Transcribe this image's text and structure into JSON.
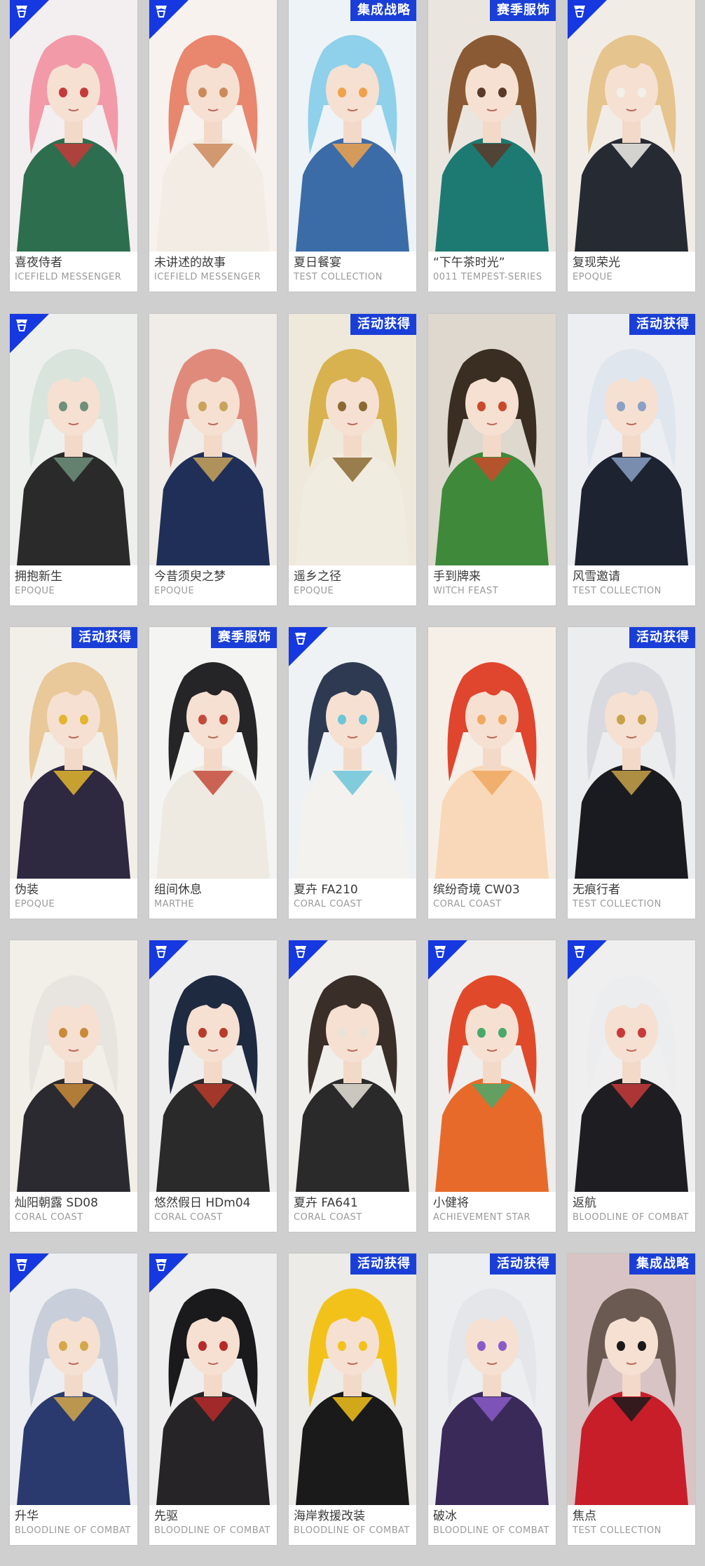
{
  "rows": [
    [
      {
        "name": "喜夜侍者",
        "series": "ICEFIELD MESSENGER",
        "tag": "",
        "corner": true,
        "palette": {
          "bg": "#f3eef0",
          "hair": "#f29aa8",
          "cloth": "#2d6e4e",
          "accent": "#c43a3a"
        }
      },
      {
        "name": "未讲述的故事",
        "series": "ICEFIELD MESSENGER",
        "tag": "",
        "corner": true,
        "palette": {
          "bg": "#f7f2ee",
          "hair": "#e8866e",
          "cloth": "#f2ece4",
          "accent": "#cc8a5a"
        }
      },
      {
        "name": "夏日餐宴",
        "series": "TEST COLLECTION",
        "tag": "集成战略",
        "corner": false,
        "palette": {
          "bg": "#eef3f7",
          "hair": "#8fd0ea",
          "cloth": "#3b6ca8",
          "accent": "#f0a24b"
        }
      },
      {
        "name": "“下午茶时光”",
        "series": "0011 TEMPEST-SERIES",
        "tag": "赛季服饰",
        "corner": false,
        "palette": {
          "bg": "#eae6df",
          "hair": "#8a5a34",
          "cloth": "#1d7a72",
          "accent": "#5a3a2a"
        }
      },
      {
        "name": "复现荣光",
        "series": "EPOQUE",
        "tag": "",
        "corner": true,
        "palette": {
          "bg": "#f1ede6",
          "hair": "#e6c48e",
          "cloth": "#262a33",
          "accent": "#f2f0ea"
        }
      }
    ],
    [
      {
        "name": "拥抱新生",
        "series": "EPOQUE",
        "tag": "",
        "corner": true,
        "palette": {
          "bg": "#eef0ee",
          "hair": "#d9e4dc",
          "cloth": "#2a2a2a",
          "accent": "#6f8f7a"
        }
      },
      {
        "name": "今昔须臾之梦",
        "series": "EPOQUE",
        "tag": "",
        "corner": false,
        "palette": {
          "bg": "#f0ece8",
          "hair": "#e08a7c",
          "cloth": "#1f2f57",
          "accent": "#c8a35a"
        }
      },
      {
        "name": "遥乡之径",
        "series": "EPOQUE",
        "tag": "活动获得",
        "corner": false,
        "palette": {
          "bg": "#efe9dc",
          "hair": "#d8b24e",
          "cloth": "#f0ece0",
          "accent": "#8a6a32"
        }
      },
      {
        "name": "手到牌来",
        "series": "WITCH FEAST",
        "tag": "",
        "corner": false,
        "palette": {
          "bg": "#ded8cf",
          "hair": "#3a2e22",
          "cloth": "#3e8a3a",
          "accent": "#c94a2a"
        }
      },
      {
        "name": "风雪邀请",
        "series": "TEST COLLECTION",
        "tag": "活动获得",
        "corner": false,
        "palette": {
          "bg": "#eceef2",
          "hair": "#dfe6ee",
          "cloth": "#1d2330",
          "accent": "#8aa0c4"
        }
      }
    ],
    [
      {
        "name": "伪装",
        "series": "EPOQUE",
        "tag": "活动获得",
        "corner": false,
        "palette": {
          "bg": "#f2efe9",
          "hair": "#e9c89a",
          "cloth": "#2e2840",
          "accent": "#e2b62e"
        }
      },
      {
        "name": "组间休息",
        "series": "MARTHE",
        "tag": "赛季服饰",
        "corner": false,
        "palette": {
          "bg": "#f4f4f2",
          "hair": "#252527",
          "cloth": "#eeeae2",
          "accent": "#c44a3a"
        }
      },
      {
        "name": "夏卉 FA210",
        "series": "CORAL COAST",
        "tag": "",
        "corner": true,
        "palette": {
          "bg": "#eef2f4",
          "hair": "#2e3a52",
          "cloth": "#f4f2ee",
          "accent": "#6cc6d8"
        }
      },
      {
        "name": "缤纷奇境 CW03",
        "series": "CORAL COAST",
        "tag": "",
        "corner": false,
        "palette": {
          "bg": "#f6efe8",
          "hair": "#e0452e",
          "cloth": "#f8d8b8",
          "accent": "#f0a860"
        }
      },
      {
        "name": "无痕行者",
        "series": "TEST COLLECTION",
        "tag": "活动获得",
        "corner": false,
        "palette": {
          "bg": "#ecedef",
          "hair": "#d8dadf",
          "cloth": "#1a1b20",
          "accent": "#c8a24a"
        }
      }
    ],
    [
      {
        "name": "灿阳朝露 SD08",
        "series": "CORAL COAST",
        "tag": "",
        "corner": false,
        "palette": {
          "bg": "#f2efe9",
          "hair": "#e8e4e0",
          "cloth": "#2a2a30",
          "accent": "#c98a3a"
        }
      },
      {
        "name": "悠然假日 HDm04",
        "series": "CORAL COAST",
        "tag": "",
        "corner": true,
        "palette": {
          "bg": "#eeeeee",
          "hair": "#1e2a40",
          "cloth": "#2a2a2a",
          "accent": "#b83a2a"
        }
      },
      {
        "name": "夏卉 FA641",
        "series": "CORAL COAST",
        "tag": "",
        "corner": true,
        "palette": {
          "bg": "#f0efec",
          "hair": "#3a2e28",
          "cloth": "#2a2a2a",
          "accent": "#e8e2d8"
        }
      },
      {
        "name": "小健将",
        "series": "ACHIEVEMENT STAR",
        "tag": "",
        "corner": true,
        "palette": {
          "bg": "#efeeec",
          "hair": "#e04a2a",
          "cloth": "#e86a2a",
          "accent": "#4aa86a"
        }
      },
      {
        "name": "返航",
        "series": "BLOODLINE OF COMBAT",
        "tag": "",
        "corner": true,
        "palette": {
          "bg": "#efefef",
          "hair": "#ecedef",
          "cloth": "#1e1e22",
          "accent": "#c83a3a"
        }
      }
    ],
    [
      {
        "name": "升华",
        "series": "BLOODLINE OF COMBAT",
        "tag": "",
        "corner": true,
        "palette": {
          "bg": "#eceef2",
          "hair": "#c8cfda",
          "cloth": "#2a3a6e",
          "accent": "#d4a84a"
        }
      },
      {
        "name": "先驱",
        "series": "BLOODLINE OF COMBAT",
        "tag": "",
        "corner": true,
        "palette": {
          "bg": "#eeeeee",
          "hair": "#1a1a1c",
          "cloth": "#262426",
          "accent": "#b82a2a"
        }
      },
      {
        "name": "海岸救援改装",
        "series": "BLOODLINE OF COMBAT",
        "tag": "活动获得",
        "corner": false,
        "palette": {
          "bg": "#ecebe8",
          "hair": "#f2c21a",
          "cloth": "#1a1a1a",
          "accent": "#f2c21a"
        }
      },
      {
        "name": "破冰",
        "series": "BLOODLINE OF COMBAT",
        "tag": "活动获得",
        "corner": false,
        "palette": {
          "bg": "#eceef0",
          "hair": "#e4e6ea",
          "cloth": "#3a2a5a",
          "accent": "#8a5ac8"
        }
      },
      {
        "name": "焦点",
        "series": "TEST COLLECTION",
        "tag": "集成战略",
        "corner": false,
        "palette": {
          "bg": "#d8c4c4",
          "hair": "#6a5a52",
          "cloth": "#c81e2a",
          "accent": "#1a1a1a"
        }
      }
    ]
  ]
}
